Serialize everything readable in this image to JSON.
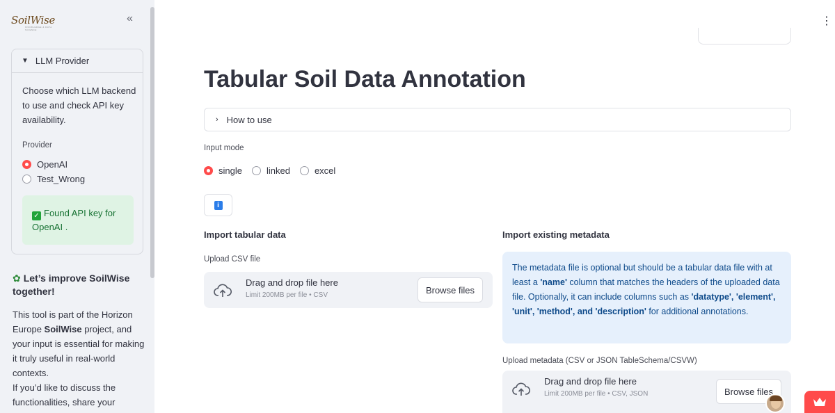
{
  "sidebar": {
    "logo_text": "SoilWise",
    "logo_tagline": "KNOWLEDGE & DATA SCIENCE",
    "collapse_label": "«",
    "expander": {
      "label": "LLM Provider",
      "description": "Choose which LLM backend to use and check API key availability.",
      "provider_label": "Provider",
      "options": [
        "OpenAI",
        "Test_Wrong"
      ],
      "selected": "OpenAI",
      "status_text": "Found API key for OpenAI ."
    },
    "improve_title": "Let’s improve SoilWise together!",
    "improve_text_1": "This tool is part of the Horizon Europe ",
    "improve_bold": "SoilWise",
    "improve_text_2": " project, and your input is essential for making it truly useful in real-world contexts.",
    "improve_text_3": "If you’d like to discuss the functionalities, share your"
  },
  "main": {
    "menu_icon": "vertical-dots-icon",
    "title": "Tabular Soil Data Annotation",
    "how_to_use": "How to use",
    "input_mode_label": "Input mode",
    "input_modes": [
      "single",
      "linked",
      "excel"
    ],
    "selected_mode": "single",
    "left": {
      "section_title": "Import tabular data",
      "upload_label": "Upload CSV file",
      "drop_text": "Drag and drop file here",
      "limit_text": "Limit 200MB per file • CSV",
      "browse_label": "Browse files"
    },
    "right": {
      "section_title": "Import existing metadata",
      "info_1": "The metadata file is optional but should be a tabular data file with at least a ",
      "info_name": "'name'",
      "info_2": " column that matches the headers of the uploaded data file. Optionally, it can include columns such as ",
      "info_cols": "'datatype', 'element', 'unit', 'method', and 'description'",
      "info_3": " for additional annotations.",
      "upload_label": "Upload metadata (CSV or JSON TableSchema/CSVW)",
      "drop_text": "Drag and drop file here",
      "limit_text": "Limit 200MB per file • CSV, JSON",
      "browse_label": "Browse files"
    }
  },
  "colors": {
    "accent": "#ff4b4b",
    "sidebar_bg": "#f0f2f6",
    "success_bg": "#dff3e4",
    "info_bg": "#e6f0fc",
    "info_text": "#0e4a8a"
  }
}
